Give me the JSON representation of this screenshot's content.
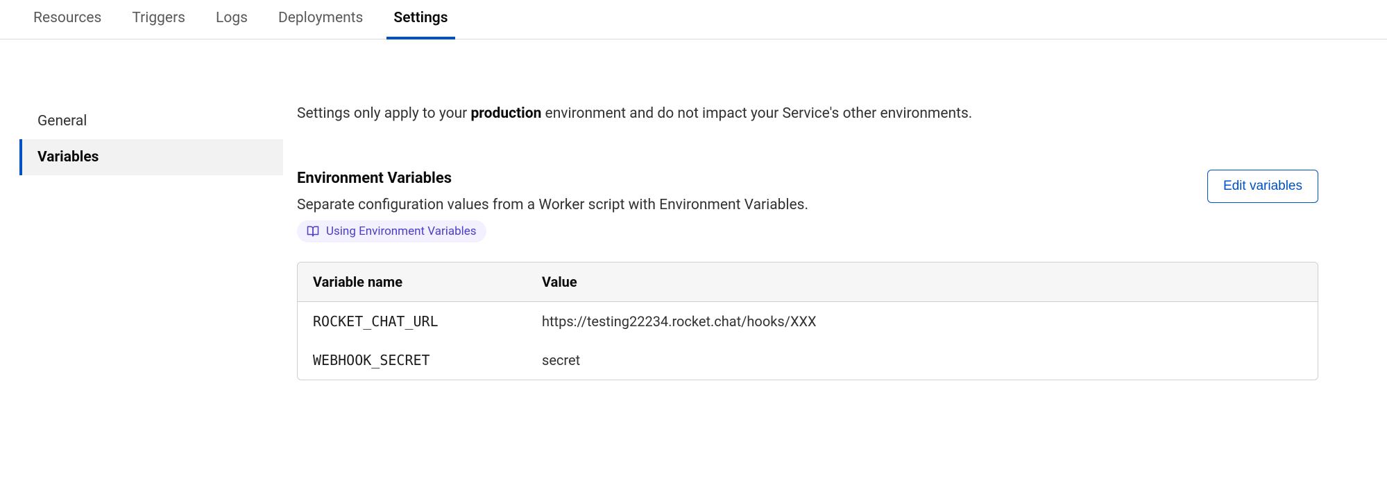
{
  "tabs": [
    {
      "label": "Resources",
      "active": false
    },
    {
      "label": "Triggers",
      "active": false
    },
    {
      "label": "Logs",
      "active": false
    },
    {
      "label": "Deployments",
      "active": false
    },
    {
      "label": "Settings",
      "active": true
    }
  ],
  "sidebar": {
    "items": [
      {
        "label": "General",
        "active": false
      },
      {
        "label": "Variables",
        "active": true
      }
    ]
  },
  "banner": {
    "prefix": "Settings only apply to your ",
    "bold": "production",
    "suffix": " environment and do not impact your Service's other environments."
  },
  "env": {
    "title": "Environment Variables",
    "description": "Separate configuration values from a Worker script with Environment Variables.",
    "doc_link_label": "Using Environment Variables",
    "edit_button": "Edit variables",
    "columns": {
      "name": "Variable name",
      "value": "Value"
    },
    "rows": [
      {
        "name": "ROCKET_CHAT_URL",
        "value": "https://testing22234.rocket.chat/hooks/XXX"
      },
      {
        "name": "WEBHOOK_SECRET",
        "value": "secret"
      }
    ]
  }
}
